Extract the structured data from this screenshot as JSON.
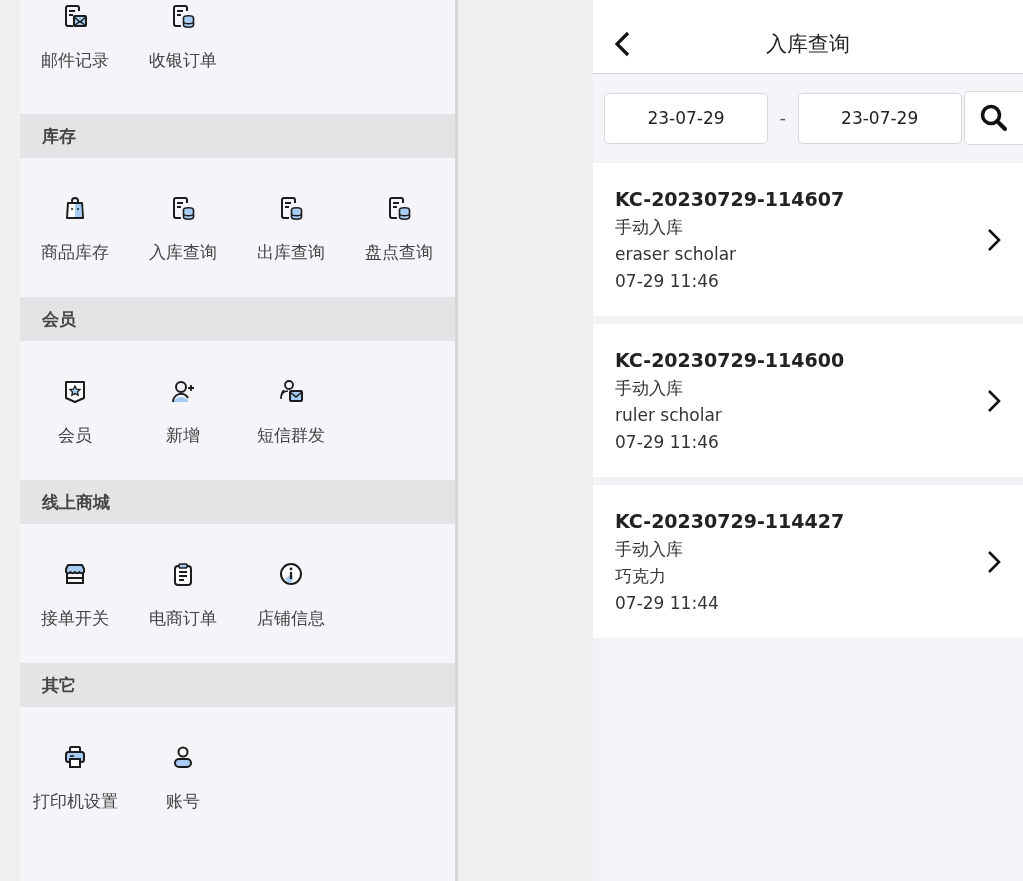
{
  "menu": {
    "top_items": [
      {
        "label": "邮件记录",
        "kind": "mail"
      },
      {
        "label": "收银订单",
        "kind": "database"
      }
    ],
    "sections": [
      {
        "title": "库存",
        "items": [
          {
            "label": "商品库存",
            "kind": "bag"
          },
          {
            "label": "入库查询",
            "kind": "database"
          },
          {
            "label": "出库查询",
            "kind": "database"
          },
          {
            "label": "盘点查询",
            "kind": "database"
          }
        ]
      },
      {
        "title": "会员",
        "items": [
          {
            "label": "会员",
            "kind": "badge"
          },
          {
            "label": "新增",
            "kind": "useradd"
          },
          {
            "label": "短信群发",
            "kind": "groupmail"
          }
        ]
      },
      {
        "title": "线上商城",
        "items": [
          {
            "label": "接单开关",
            "kind": "store"
          },
          {
            "label": "电商订单",
            "kind": "clipboard"
          },
          {
            "label": "店铺信息",
            "kind": "info"
          }
        ]
      },
      {
        "title": "其它",
        "items": [
          {
            "label": "打印机设置",
            "kind": "printer"
          },
          {
            "label": "账号",
            "kind": "person"
          }
        ]
      }
    ]
  },
  "query": {
    "title": "入库查询",
    "date_from": "23-07-29",
    "separator": "-",
    "date_to": "23-07-29",
    "records": [
      {
        "id": "KC-20230729-114607",
        "type": "手动入库",
        "product": "eraser scholar",
        "time": "07-29 11:46"
      },
      {
        "id": "KC-20230729-114600",
        "type": "手动入库",
        "product": "ruler scholar",
        "time": "07-29 11:46"
      },
      {
        "id": "KC-20230729-114427",
        "type": "手动入库",
        "product": "巧克力",
        "time": "07-29 11:44"
      }
    ]
  }
}
